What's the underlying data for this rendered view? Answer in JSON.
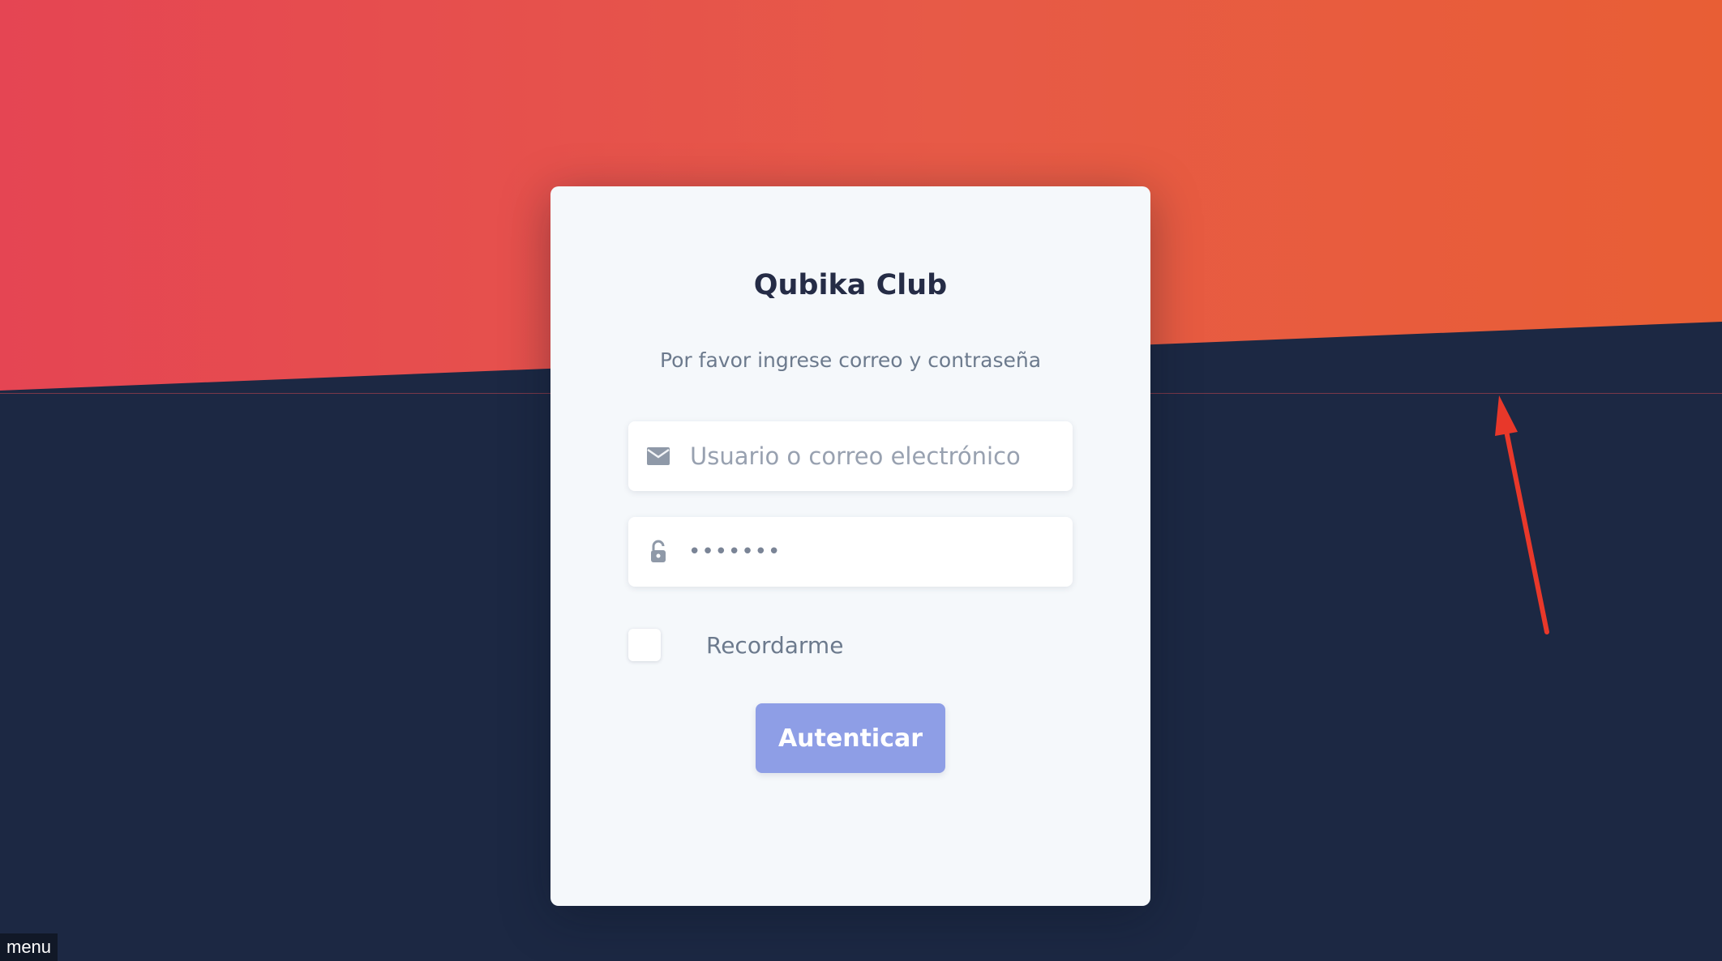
{
  "login": {
    "title": "Qubika Club",
    "subtitle": "Por favor ingrese correo y contraseña",
    "email": {
      "placeholder": "Usuario o correo electrónico",
      "value": "",
      "icon": "envelope-icon"
    },
    "password": {
      "display": "•••••••",
      "icon": "unlocked-padlock-icon"
    },
    "remember_label": "Recordarme",
    "remember_checked": false,
    "submit_label": "Autenticar"
  },
  "footer": {
    "menu_label": "menu"
  },
  "colors": {
    "background_dark": "#1c2843",
    "gradient_start": "#e54553",
    "gradient_end": "#e85e35",
    "card_bg": "#f5f8fb",
    "button_bg": "#8e9ee6",
    "annotation_arrow": "#e8382a"
  }
}
